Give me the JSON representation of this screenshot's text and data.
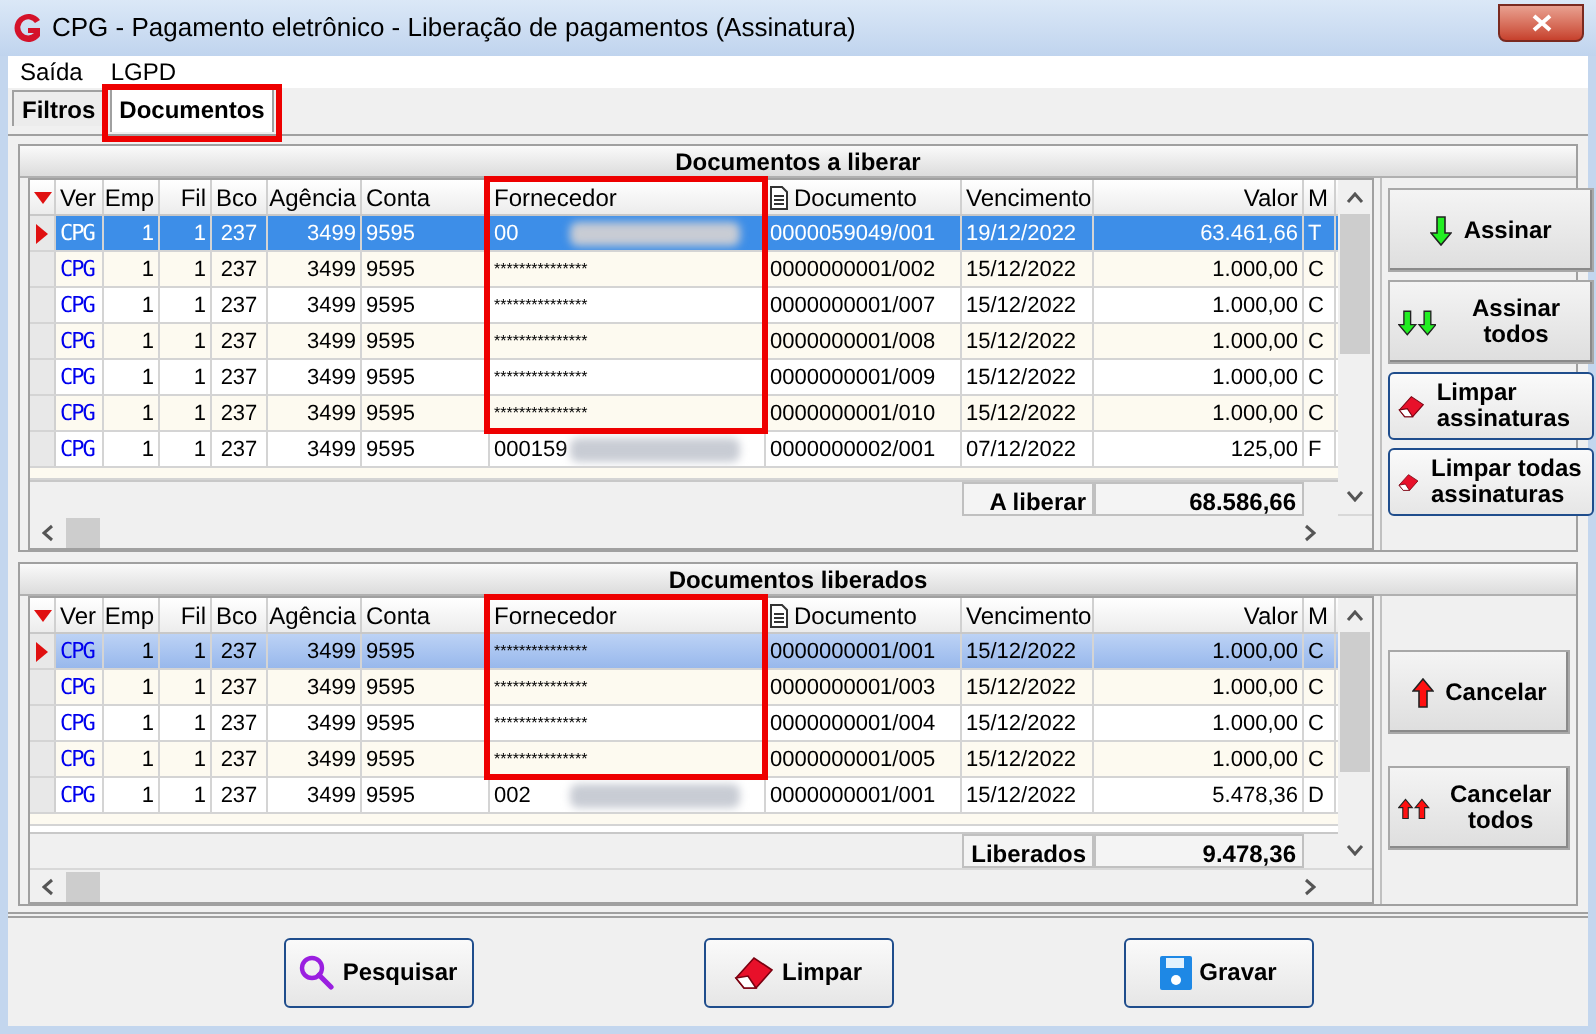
{
  "window": {
    "title": "CPG - Pagamento eletrônico - Liberação de pagamentos (Assinatura)"
  },
  "menu": [
    {
      "label": "Saída"
    },
    {
      "label": "LGPD"
    }
  ],
  "tabs": [
    {
      "label": "Filtros",
      "selected": false,
      "boxed": false
    },
    {
      "label": "Documentos",
      "selected": true,
      "boxed": true
    }
  ],
  "panels": [
    {
      "title": "Documentos a liberar",
      "columns": [
        {
          "label": "Ver",
          "kind": "plain",
          "boxed": false
        },
        {
          "label": "Emp",
          "kind": "plain",
          "boxed": false
        },
        {
          "label": "Fil",
          "kind": "plain",
          "boxed": false
        },
        {
          "label": "Bco",
          "kind": "plain",
          "boxed": false
        },
        {
          "label": "Agência",
          "kind": "plain",
          "boxed": false
        },
        {
          "label": "Conta",
          "kind": "plain",
          "boxed": false
        },
        {
          "label": "Fornecedor",
          "kind": "plain",
          "boxed": true
        },
        {
          "label": "Documento",
          "kind": "document",
          "boxed": false
        },
        {
          "label": "Vencimento",
          "kind": "plain",
          "boxed": false
        },
        {
          "label": "Valor",
          "kind": "plain",
          "boxed": false
        },
        {
          "label": "M",
          "kind": "plain",
          "boxed": false
        }
      ],
      "rows": [
        {
          "selected": true,
          "boxed": true,
          "redacted": true,
          "cells": [
            "CPG",
            "1",
            "1",
            "237",
            "3499",
            "9595",
            "00",
            "0000059049/001",
            "19/12/2022",
            "63.461,66",
            "T"
          ]
        },
        {
          "selected": false,
          "boxed": true,
          "redacted": false,
          "cells": [
            "CPG",
            "1",
            "1",
            "237",
            "3499",
            "9595",
            "***************",
            "0000000001/002",
            "15/12/2022",
            "1.000,00",
            "C"
          ]
        },
        {
          "selected": false,
          "boxed": true,
          "redacted": false,
          "cells": [
            "CPG",
            "1",
            "1",
            "237",
            "3499",
            "9595",
            "***************",
            "0000000001/007",
            "15/12/2022",
            "1.000,00",
            "C"
          ]
        },
        {
          "selected": false,
          "boxed": true,
          "redacted": false,
          "cells": [
            "CPG",
            "1",
            "1",
            "237",
            "3499",
            "9595",
            "***************",
            "0000000001/008",
            "15/12/2022",
            "1.000,00",
            "C"
          ]
        },
        {
          "selected": false,
          "boxed": true,
          "redacted": false,
          "cells": [
            "CPG",
            "1",
            "1",
            "237",
            "3499",
            "9595",
            "***************",
            "0000000001/009",
            "15/12/2022",
            "1.000,00",
            "C"
          ]
        },
        {
          "selected": false,
          "boxed": true,
          "redacted": false,
          "cells": [
            "CPG",
            "1",
            "1",
            "237",
            "3499",
            "9595",
            "***************",
            "0000000001/010",
            "15/12/2022",
            "1.000,00",
            "C"
          ]
        },
        {
          "selected": false,
          "boxed": false,
          "redacted": true,
          "cells": [
            "CPG",
            "1",
            "1",
            "237",
            "3499",
            "9595",
            "000159",
            "0000000002/001",
            "07/12/2022",
            "125,00",
            "F"
          ]
        }
      ],
      "total_label": "A liberar",
      "total": "68.586,66",
      "buttons": [
        {
          "label": "Assinar",
          "kind": "flat"
        },
        {
          "label": "Assinar todos",
          "kind": "flat"
        },
        {
          "label": "Limpar assinaturas",
          "kind": "outlined"
        },
        {
          "label": "Limpar todas assinaturas",
          "kind": "outlined"
        }
      ]
    },
    {
      "title": "Documentos liberados",
      "columns": [
        {
          "label": "Ver",
          "kind": "plain",
          "boxed": false
        },
        {
          "label": "Emp",
          "kind": "plain",
          "boxed": false
        },
        {
          "label": "Fil",
          "kind": "plain",
          "boxed": false
        },
        {
          "label": "Bco",
          "kind": "plain",
          "boxed": false
        },
        {
          "label": "Agência",
          "kind": "plain",
          "boxed": false
        },
        {
          "label": "Conta",
          "kind": "plain",
          "boxed": false
        },
        {
          "label": "Fornecedor",
          "kind": "plain",
          "boxed": true
        },
        {
          "label": "Documento",
          "kind": "document",
          "boxed": false
        },
        {
          "label": "Vencimento",
          "kind": "plain",
          "boxed": false
        },
        {
          "label": "Valor",
          "kind": "plain",
          "boxed": false
        },
        {
          "label": "M",
          "kind": "plain",
          "boxed": false
        }
      ],
      "rows": [
        {
          "selected": true,
          "boxed": true,
          "redacted": false,
          "cells": [
            "CPG",
            "1",
            "1",
            "237",
            "3499",
            "9595",
            "***************",
            "0000000001/001",
            "15/12/2022",
            "1.000,00",
            "C"
          ]
        },
        {
          "selected": false,
          "boxed": true,
          "redacted": false,
          "cells": [
            "CPG",
            "1",
            "1",
            "237",
            "3499",
            "9595",
            "***************",
            "0000000001/003",
            "15/12/2022",
            "1.000,00",
            "C"
          ]
        },
        {
          "selected": false,
          "boxed": true,
          "redacted": false,
          "cells": [
            "CPG",
            "1",
            "1",
            "237",
            "3499",
            "9595",
            "***************",
            "0000000001/004",
            "15/12/2022",
            "1.000,00",
            "C"
          ]
        },
        {
          "selected": false,
          "boxed": true,
          "redacted": false,
          "cells": [
            "CPG",
            "1",
            "1",
            "237",
            "3499",
            "9595",
            "***************",
            "0000000001/005",
            "15/12/2022",
            "1.000,00",
            "C"
          ]
        },
        {
          "selected": false,
          "boxed": false,
          "redacted": true,
          "cells": [
            "CPG",
            "1",
            "1",
            "237",
            "3499",
            "9595",
            "002",
            "0000000001/001",
            "15/12/2022",
            "5.478,36",
            "D"
          ]
        }
      ],
      "total_label": "Liberados",
      "total": "9.478,36",
      "buttons": [
        {
          "label": "Cancelar",
          "kind": "flat"
        },
        {
          "label": "Cancelar todos",
          "kind": "flat"
        }
      ]
    }
  ],
  "footer_buttons": [
    {
      "label": "Pesquisar"
    },
    {
      "label": "Limpar"
    },
    {
      "label": "Gravar"
    }
  ]
}
